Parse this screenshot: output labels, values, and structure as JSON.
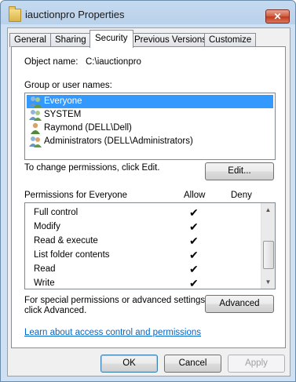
{
  "window": {
    "title": "iauctionpro Properties",
    "close_glyph": "✕"
  },
  "tabs": [
    {
      "label": "General"
    },
    {
      "label": "Sharing"
    },
    {
      "label": "Security"
    },
    {
      "label": "Previous Versions"
    },
    {
      "label": "Customize"
    }
  ],
  "security": {
    "object_name_label": "Object name:",
    "object_name_value": "C:\\iauctionpro",
    "group_label": "Group or user names:",
    "users": [
      {
        "name": "Everyone",
        "icon": "group-icon"
      },
      {
        "name": "SYSTEM",
        "icon": "group-icon"
      },
      {
        "name": "Raymond (DELL\\Dell)",
        "icon": "user-icon"
      },
      {
        "name": "Administrators (DELL\\Administrators)",
        "icon": "group-icon"
      }
    ],
    "change_text": "To change permissions, click Edit.",
    "edit_button": "Edit...",
    "permissions_label": "Permissions for Everyone",
    "allow_header": "Allow",
    "deny_header": "Deny",
    "permissions": [
      {
        "name": "Full control",
        "allow": "✔"
      },
      {
        "name": "Modify",
        "allow": "✔"
      },
      {
        "name": "Read & execute",
        "allow": "✔"
      },
      {
        "name": "List folder contents",
        "allow": "✔"
      },
      {
        "name": "Read",
        "allow": "✔"
      },
      {
        "name": "Write",
        "allow": "✔"
      }
    ],
    "special_text_1": "For special permissions or advanced settings,",
    "special_text_2": "click Advanced.",
    "advanced_button": "Advanced",
    "learn_link": "Learn about access control and permissions"
  },
  "buttons": {
    "ok": "OK",
    "cancel": "Cancel",
    "apply": "Apply"
  },
  "colors": {
    "selection": "#3399ff",
    "link": "#0066cc"
  }
}
